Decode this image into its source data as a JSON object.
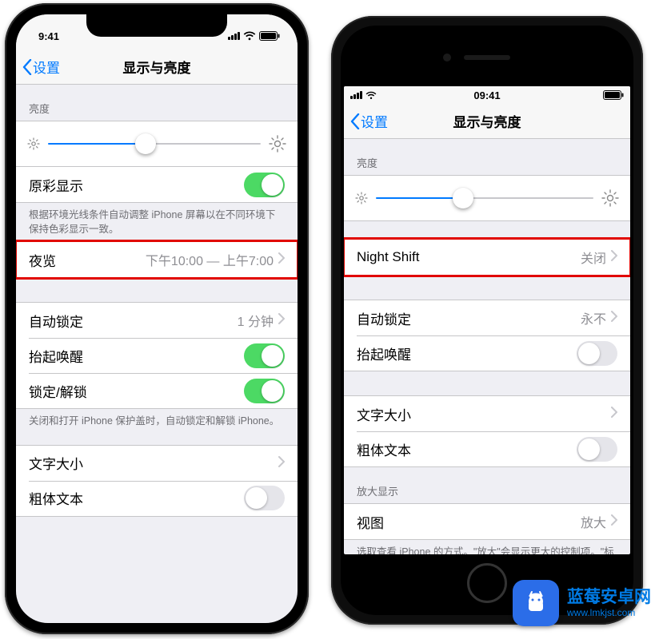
{
  "phone_x": {
    "statusbar": {
      "time": "9:41"
    },
    "nav": {
      "back": "设置",
      "title": "显示与亮度"
    },
    "sections": {
      "brightness_header": "亮度",
      "slider_percent": 46,
      "true_tone_label": "原彩显示",
      "true_tone_on": true,
      "true_tone_footer": "根据环境光线条件自动调整 iPhone 屏幕以在不同环境下保持色彩显示一致。",
      "night_shift_label": "夜览",
      "night_shift_detail": "下午10:00 — 上午7:00",
      "auto_lock_label": "自动锁定",
      "auto_lock_detail": "1 分钟",
      "raise_wake_label": "抬起唤醒",
      "raise_wake_on": true,
      "lock_unlock_label": "锁定/解锁",
      "lock_unlock_on": true,
      "lock_footer": "关闭和打开 iPhone 保护盖时，自动锁定和解锁 iPhone。",
      "text_size_label": "文字大小",
      "bold_text_label": "粗体文本",
      "bold_text_on": false
    }
  },
  "phone_8": {
    "statusbar": {
      "time": "09:41"
    },
    "nav": {
      "back": "设置",
      "title": "显示与亮度"
    },
    "sections": {
      "brightness_header": "亮度",
      "slider_percent": 40,
      "night_shift_label": "Night Shift",
      "night_shift_detail": "关闭",
      "auto_lock_label": "自动锁定",
      "auto_lock_detail": "永不",
      "raise_wake_label": "抬起唤醒",
      "raise_wake_on": false,
      "text_size_label": "文字大小",
      "bold_text_label": "粗体文本",
      "bold_text_on": false,
      "zoom_header": "放大显示",
      "zoom_view_label": "视图",
      "zoom_view_detail": "放大",
      "zoom_footer": "选取查看 iPhone 的方式。\"放大\"会显示更大的控制项。\"标准\"会显示更多的内容。"
    }
  },
  "watermark": {
    "line1": "蓝莓安卓网",
    "line2": "www.lmkjst.com"
  }
}
